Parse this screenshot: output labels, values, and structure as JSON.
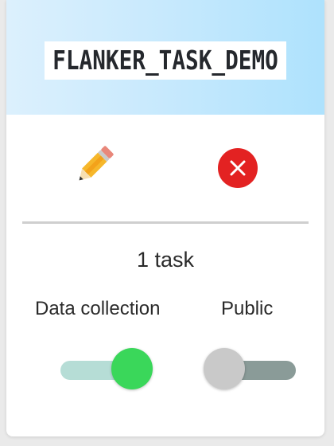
{
  "experiment": {
    "title": "FLANKER_TASK_DEMO",
    "task_count_label": "1 task"
  },
  "actions": {
    "edit_icon": "pencil-icon",
    "delete_icon": "close-circle-icon"
  },
  "toggles": {
    "data_collection": {
      "label": "Data collection",
      "on": true
    },
    "public": {
      "label": "Public",
      "on": false
    }
  },
  "colors": {
    "header_gradient_start": "#dcf0fd",
    "header_gradient_end": "#aee2fd",
    "toggle_on_thumb": "#3ad75a",
    "toggle_on_track": "#b6ddd6",
    "toggle_off_thumb": "#c9c9c9",
    "toggle_off_track": "#8a9b98",
    "delete_red": "#e32222"
  }
}
